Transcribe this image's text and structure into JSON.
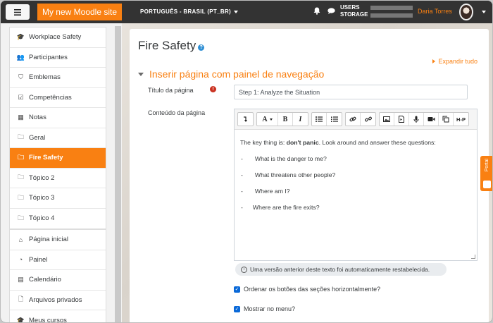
{
  "navbar": {
    "site_name": "My new Moodle site",
    "language": "PORTUGUÊS - BRASIL (PT_BR)",
    "users_label": "USERS",
    "storage_label": "STORAGE",
    "user_name": "Daria Torres"
  },
  "sidebar": {
    "course_items": [
      {
        "label": "Workplace Safety",
        "icon": "graduation-cap-icon"
      },
      {
        "label": "Participantes",
        "icon": "users-icon"
      },
      {
        "label": "Emblemas",
        "icon": "shield-icon"
      },
      {
        "label": "Competências",
        "icon": "checkbox-icon"
      },
      {
        "label": "Notas",
        "icon": "table-icon"
      },
      {
        "label": "Geral",
        "icon": "folder-icon"
      },
      {
        "label": "Fire Safety",
        "icon": "folder-icon",
        "active": true
      },
      {
        "label": "Tópico 2",
        "icon": "folder-icon"
      },
      {
        "label": "Tópico 3",
        "icon": "folder-icon"
      },
      {
        "label": "Tópico 4",
        "icon": "folder-icon"
      }
    ],
    "site_items": [
      {
        "label": "Página inicial",
        "icon": "home-icon"
      },
      {
        "label": "Painel",
        "icon": "dashboard-icon"
      },
      {
        "label": "Calendário",
        "icon": "calendar-icon"
      },
      {
        "label": "Arquivos privados",
        "icon": "file-icon"
      },
      {
        "label": "Meus cursos",
        "icon": "graduation-cap-icon"
      }
    ]
  },
  "main": {
    "page_title": "Fire Safety",
    "expand_all": "Expandir tudo",
    "section_title": "Inserir página com painel de navegação",
    "page_title_label": "Título da página",
    "page_title_value": "Step 1: Analyze the Situation",
    "content_label": "Conteúdo da página",
    "content": {
      "intro_prefix": "The key thing is: ",
      "intro_bold": "don't panic",
      "intro_suffix": ". Look around and answer these questions:",
      "bullets": [
        "What is the danger to me?",
        "What threatens other people?",
        "Where am I?",
        "Where are the fire exits?"
      ],
      "bullet_marker": "-"
    },
    "restore_note": "Uma versão anterior deste texto foi automaticamente restabelecida.",
    "checkbox_horizontal": "Ordenar os botões das seções horizontalmente?",
    "checkbox_menu": "Mostrar no menu?",
    "portal_label": "Portal"
  },
  "toolbar": {
    "font_label": "A",
    "bold_label": "B",
    "italic_label": "I",
    "h5p_label": "H-P"
  },
  "colors": {
    "brand_orange": "#f98012",
    "navbar_bg": "#333333",
    "checkbox_blue": "#0a69d8",
    "required_red": "#ca3120"
  }
}
